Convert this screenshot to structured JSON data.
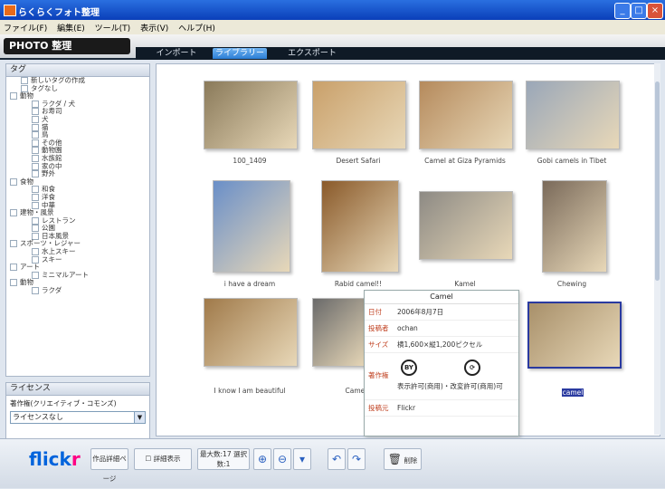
{
  "window": {
    "title": "らくらくフォト整理"
  },
  "menu": [
    "ファイル(F)",
    "編集(E)",
    "ツール(T)",
    "表示(V)",
    "ヘルプ(H)"
  ],
  "brand": {
    "logo_text": "PHOTO 整理"
  },
  "tabs": [
    {
      "label": "インポート",
      "active": false
    },
    {
      "label": "ライブラリー",
      "active": true
    },
    {
      "label": "エクスポート",
      "active": false
    }
  ],
  "sidebar": {
    "tags_header": "タグ",
    "tree": [
      {
        "label": "新しいタグの作成",
        "level": 1
      },
      {
        "label": "タグなし",
        "level": 1
      },
      {
        "label": "動物",
        "level": 0
      },
      {
        "label": "ラクダ / 犬",
        "level": 2
      },
      {
        "label": "お寿司",
        "level": 2
      },
      {
        "label": "犬",
        "level": 2
      },
      {
        "label": "猫",
        "level": 2
      },
      {
        "label": "鳥",
        "level": 2
      },
      {
        "label": "その他",
        "level": 2
      },
      {
        "label": "動物園",
        "level": 2
      },
      {
        "label": "水族館",
        "level": 2
      },
      {
        "label": "家の中",
        "level": 2
      },
      {
        "label": "野外",
        "level": 2
      },
      {
        "label": "食物",
        "level": 0
      },
      {
        "label": "和食",
        "level": 2
      },
      {
        "label": "洋食",
        "level": 2
      },
      {
        "label": "中華",
        "level": 2
      },
      {
        "label": "建物・風景",
        "level": 0
      },
      {
        "label": "レストラン",
        "level": 2
      },
      {
        "label": "公園",
        "level": 2
      },
      {
        "label": "日本風景",
        "level": 2
      },
      {
        "label": "スポーツ・レジャー",
        "level": 0
      },
      {
        "label": "水上スキー",
        "level": 2
      },
      {
        "label": "スキー",
        "level": 2
      },
      {
        "label": "アート",
        "level": 0
      },
      {
        "label": "ミニマルアート",
        "level": 2
      },
      {
        "label": "動物",
        "level": 0
      },
      {
        "label": "ラクダ",
        "level": 2
      }
    ],
    "license_header": "ライセンス",
    "license_label": "著作権(クリエイティブ・コモンズ)",
    "license_value": "ライセンスなし"
  },
  "photos": [
    {
      "caption": "100_1409",
      "color": "#8a7a5a"
    },
    {
      "caption": "Desert Safari",
      "color": "#c9a06a"
    },
    {
      "caption": "Camel at Giza Pyramids",
      "color": "#b58a5c"
    },
    {
      "caption": "Gobi camels in Tibet",
      "color": "#9aa7b8"
    },
    {
      "caption": "i have a dream",
      "color": "#6a8fc8"
    },
    {
      "caption": "Rabid camel!!",
      "color": "#8a5a2a"
    },
    {
      "caption": "Kamel",
      "color": "#8d8a84"
    },
    {
      "caption": "Chewing",
      "color": "#7a6a5a"
    },
    {
      "caption": "I know I am beautiful",
      "color": "#a07a4a"
    },
    {
      "caption": "Came...",
      "color": "#6a6a6a"
    },
    {
      "caption": "camel",
      "color": "#a8906a"
    }
  ],
  "popup": {
    "title": "Camel",
    "rows": [
      {
        "key": "日付",
        "value": "2006年8月7日"
      },
      {
        "key": "投稿者",
        "value": "ochan"
      },
      {
        "key": "サイズ",
        "value": "横1,600×縦1,200ピクセル"
      },
      {
        "key": "著作権",
        "value": "表示許可(商用)・改変許可(商用)可"
      },
      {
        "key": "投稿元",
        "value": "Flickr"
      }
    ]
  },
  "bottombar": {
    "flickr": "flickr",
    "detail_btn": "作品詳細ページ",
    "detail_toggle": "詳細表示",
    "count": "最大数:17 選択数:1",
    "delete": "削除"
  }
}
